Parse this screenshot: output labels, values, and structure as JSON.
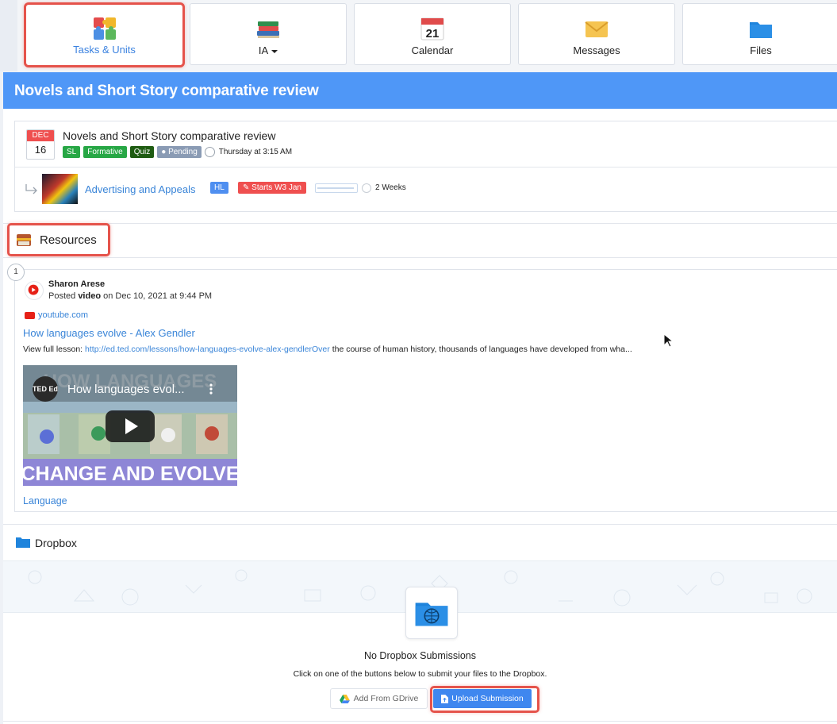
{
  "nav": {
    "tabs": [
      {
        "label": "Tasks & Units",
        "icon": "puzzle-icon",
        "active": true
      },
      {
        "label": "IA",
        "icon": "books-icon",
        "dropdown": true
      },
      {
        "label": "Calendar",
        "icon": "calendar-icon",
        "day": "21"
      },
      {
        "label": "Messages",
        "icon": "envelope-icon"
      },
      {
        "label": "Files",
        "icon": "folder-icon"
      }
    ]
  },
  "banner": {
    "title": "Novels and Short Story comparative review"
  },
  "task": {
    "month": "DEC",
    "day": "16",
    "title": "Novels and Short Story comparative review",
    "badges": {
      "sl": "SL",
      "formative": "Formative",
      "quiz": "Quiz",
      "pending": "Pending"
    },
    "time": "Thursday at 3:15 AM",
    "unit": {
      "link": "Advertising and Appeals",
      "level": "HL",
      "starts": "Starts W3 Jan",
      "progress": 0.92,
      "duration": "2 Weeks"
    }
  },
  "resources": {
    "title": "Resources",
    "count": "1",
    "post": {
      "author": "Sharon Arese",
      "posted_prefix": "Posted",
      "posted_type": "video",
      "posted_suffix": "on Dec 10, 2021 at 9:44 PM",
      "source": "youtube.com",
      "video_title": "How languages evolve - Alex Gendler",
      "desc_prefix": "View full lesson: ",
      "desc_link": "http://ed.ted.com/lessons/how-languages-evolve-alex-gendlerOver",
      "desc_rest": " the course of human history, thousands of languages have developed from wha...",
      "thumb_title": "How languages evol...",
      "thumb_badge": "TED Ed",
      "thumb_top_text": "HOW LANGUAGES",
      "thumb_caption": "CHANGE AND EVOLVE",
      "tag": "Language"
    }
  },
  "dropbox": {
    "title": "Dropbox",
    "empty_title": "No Dropbox Submissions",
    "hint": "Click on one of the buttons below to submit your files to the Dropbox.",
    "gdrive_button": "Add From GDrive",
    "upload_button": "Upload Submission"
  },
  "colors": {
    "accent": "#4f97f7",
    "link": "#3a85d8",
    "highlight_outline": "#e5534b",
    "success": "#27a745",
    "danger": "#ef4f4f"
  }
}
